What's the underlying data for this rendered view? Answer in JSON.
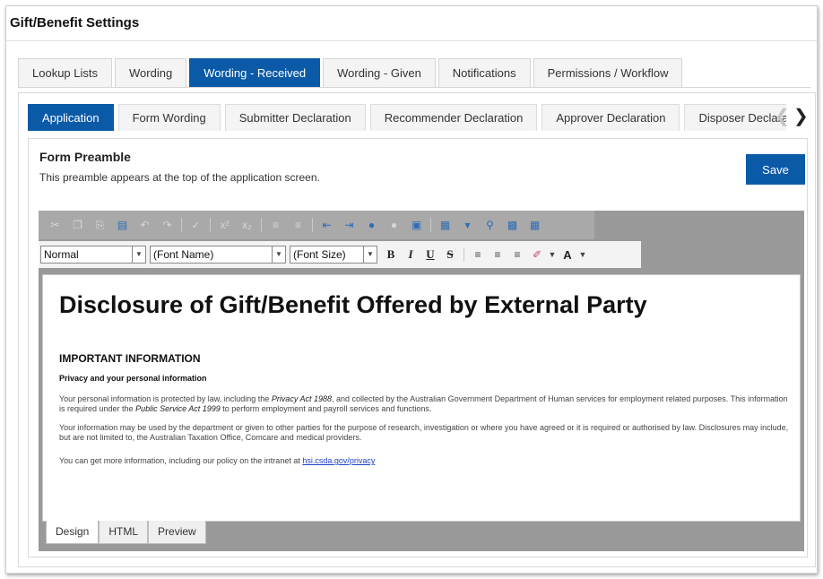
{
  "page": {
    "title": "Gift/Benefit Settings"
  },
  "top_tabs": [
    {
      "label": "Lookup Lists"
    },
    {
      "label": "Wording"
    },
    {
      "label": "Wording - Received"
    },
    {
      "label": "Wording - Given"
    },
    {
      "label": "Notifications"
    },
    {
      "label": "Permissions / Workflow"
    }
  ],
  "top_tabs_active": "Wording - Received",
  "sub_tabs": [
    {
      "label": "Application"
    },
    {
      "label": "Form Wording"
    },
    {
      "label": "Submitter Declaration"
    },
    {
      "label": "Recommender Declaration"
    },
    {
      "label": "Approver Declaration"
    },
    {
      "label": "Disposer Declaration"
    }
  ],
  "sub_tabs_active": "Application",
  "section": {
    "title": "Form Preamble",
    "description": "This preamble appears at the top of the application screen.",
    "save_label": "Save"
  },
  "editor": {
    "toolbar_row1_icons": [
      "cut-icon",
      "copy-icon",
      "paste-icon",
      "paste-word-icon",
      "undo-icon",
      "redo-icon",
      "spellcheck-icon",
      "superscript-icon",
      "subscript-icon",
      "bullet-list-icon",
      "numbered-list-icon",
      "outdent-icon",
      "indent-icon",
      "insert-link-icon",
      "remove-link-icon",
      "insert-image-icon",
      "insert-table-icon",
      "find-icon",
      "fullscreen-icon",
      "template-icon"
    ],
    "format_select": "Normal",
    "font_name_select": "(Font Name)",
    "font_size_select": "(Font Size)",
    "format_buttons": {
      "bold": "B",
      "italic": "I",
      "underline": "U",
      "strike": "S",
      "text_color": "A"
    },
    "view_tabs": [
      {
        "label": "Design"
      },
      {
        "label": "HTML"
      },
      {
        "label": "Preview"
      }
    ],
    "view_active": "Design"
  },
  "document": {
    "title": "Disclosure of Gift/Benefit Offered by External Party",
    "heading": "IMPORTANT INFORMATION",
    "subheading": "Privacy and your personal information",
    "p1_a": "Your personal information is protected by law, including the ",
    "p1_em1": "Privacy Act 1988",
    "p1_b": ", and collected by the Australian Government Department of Human services for employment related purposes. This information is required under the ",
    "p1_em2": "Public Service Act 1999",
    "p1_c": " to perform employment and payroll services and functions.",
    "p2": "Your information may be used by the department or given to other parties for the purpose of research, investigation or where you have agreed or it is required or authorised by law. Disclosures may include, but are not limited to, the Australian Taxation Office, Comcare and medical providers.",
    "p3_a": "You can get more information, including our policy on the intranet at ",
    "p3_link": "hsi.csda.gov/privacy"
  },
  "colors": {
    "accent": "#0b5aa8",
    "link": "#1a3fc9",
    "toolbar_bg": "#a9a9a9",
    "editor_frame": "#999999"
  }
}
